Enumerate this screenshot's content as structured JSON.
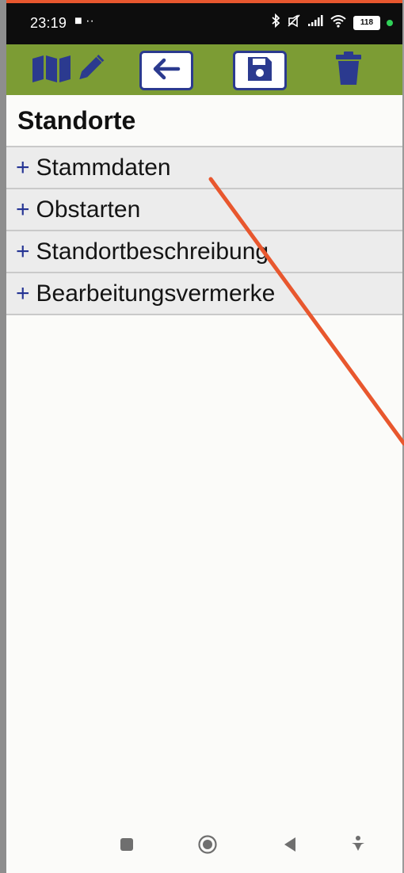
{
  "status_bar": {
    "time": "23:19",
    "left_icons": "■ ··",
    "battery": "118"
  },
  "toolbar": {
    "buttons": [
      {
        "name": "map-edit",
        "icon": "map-pencil-icon"
      },
      {
        "name": "back",
        "icon": "arrow-left-icon"
      },
      {
        "name": "save",
        "icon": "floppy-disk-icon"
      },
      {
        "name": "delete",
        "icon": "trash-icon"
      }
    ]
  },
  "page": {
    "title": "Standorte",
    "sections": [
      {
        "prefix": "+",
        "label": "Stammdaten"
      },
      {
        "prefix": "+",
        "label": "Obstarten"
      },
      {
        "prefix": "+",
        "label": "Standortbeschreibung"
      },
      {
        "prefix": "+",
        "label": "Bearbeitungsvermerke"
      }
    ]
  },
  "colors": {
    "toolbar": "#7c9c34",
    "icon_blue": "#2b3a8f",
    "accent": "#e8572e",
    "status_bar": "#0d0d0d"
  }
}
